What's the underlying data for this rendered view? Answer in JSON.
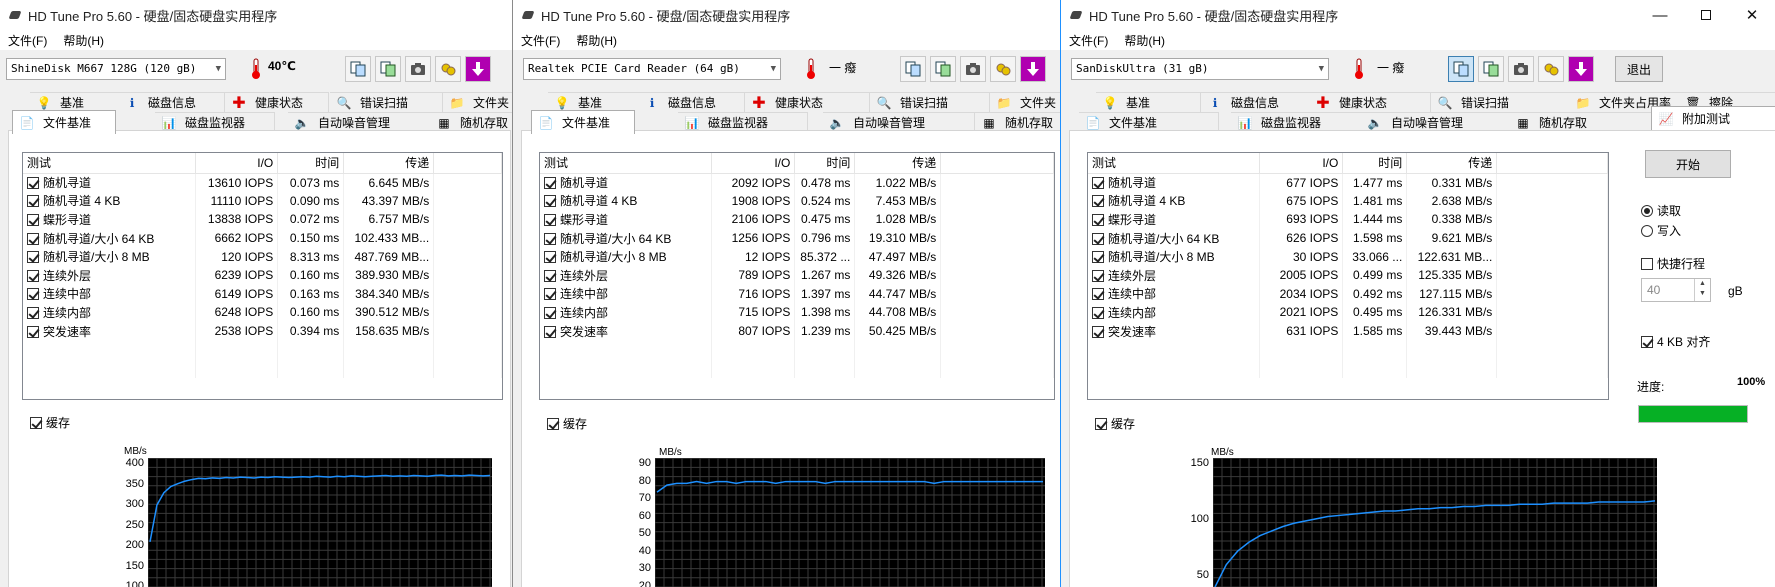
{
  "windows": [
    {
      "title": "HD Tune Pro 5.60 - 硬盘/固态硬盘实用程序",
      "menu": [
        "文件(F)",
        "帮助(H)"
      ],
      "drive": "ShineDisk M667 128G (120 gB)",
      "temperature": "40℃",
      "tabs_row1": [
        "基准",
        "磁盘信息",
        "健康状态",
        "错误扫描",
        "文件夹"
      ],
      "tabs_row2": [
        "文件基准",
        "磁盘监视器",
        "自动噪音管理",
        "随机存取"
      ],
      "table_headers": [
        "测试",
        "I/O",
        "时间",
        "传递"
      ],
      "rows": [
        {
          "test": "随机寻道",
          "io": "13610 IOPS",
          "time": "0.073 ms",
          "transfer": "6.645 MB/s"
        },
        {
          "test": "随机寻道 4 KB",
          "io": "11110 IOPS",
          "time": "0.090 ms",
          "transfer": "43.397 MB/s"
        },
        {
          "test": "蝶形寻道",
          "io": "13838 IOPS",
          "time": "0.072 ms",
          "transfer": "6.757 MB/s"
        },
        {
          "test": "随机寻道/大小 64 KB",
          "io": "6662 IOPS",
          "time": "0.150 ms",
          "transfer": "102.433 MB..."
        },
        {
          "test": "随机寻道/大小 8 MB",
          "io": "120 IOPS",
          "time": "8.313 ms",
          "transfer": "487.769 MB..."
        },
        {
          "test": "连续外层",
          "io": "6239 IOPS",
          "time": "0.160 ms",
          "transfer": "389.930 MB/s"
        },
        {
          "test": "连续中部",
          "io": "6149 IOPS",
          "time": "0.163 ms",
          "transfer": "384.340 MB/s"
        },
        {
          "test": "连续内部",
          "io": "6248 IOPS",
          "time": "0.160 ms",
          "transfer": "390.512 MB/s"
        },
        {
          "test": "突发速率",
          "io": "2538 IOPS",
          "time": "0.394 ms",
          "transfer": "158.635 MB/s"
        }
      ],
      "cache_label": "缓存"
    },
    {
      "title": "HD Tune Pro 5.60 - 硬盘/固态硬盘实用程序",
      "menu": [
        "文件(F)",
        "帮助(H)"
      ],
      "drive": "Realtek PCIE Card Reader (64 gB)",
      "temperature": "一 癈",
      "tabs_row1": [
        "基准",
        "磁盘信息",
        "健康状态",
        "错误扫描",
        "文件夹"
      ],
      "tabs_row2": [
        "文件基准",
        "磁盘监视器",
        "自动噪音管理",
        "随机存取"
      ],
      "table_headers": [
        "测试",
        "I/O",
        "时间",
        "传递"
      ],
      "rows": [
        {
          "test": "随机寻道",
          "io": "2092 IOPS",
          "time": "0.478 ms",
          "transfer": "1.022 MB/s"
        },
        {
          "test": "随机寻道 4 KB",
          "io": "1908 IOPS",
          "time": "0.524 ms",
          "transfer": "7.453 MB/s"
        },
        {
          "test": "蝶形寻道",
          "io": "2106 IOPS",
          "time": "0.475 ms",
          "transfer": "1.028 MB/s"
        },
        {
          "test": "随机寻道/大小 64 KB",
          "io": "1256 IOPS",
          "time": "0.796 ms",
          "transfer": "19.310 MB/s"
        },
        {
          "test": "随机寻道/大小 8 MB",
          "io": "12 IOPS",
          "time": "85.372 ...",
          "transfer": "47.497 MB/s"
        },
        {
          "test": "连续外层",
          "io": "789 IOPS",
          "time": "1.267 ms",
          "transfer": "49.326 MB/s"
        },
        {
          "test": "连续中部",
          "io": "716 IOPS",
          "time": "1.397 ms",
          "transfer": "44.747 MB/s"
        },
        {
          "test": "连续内部",
          "io": "715 IOPS",
          "time": "1.398 ms",
          "transfer": "44.708 MB/s"
        },
        {
          "test": "突发速率",
          "io": "807 IOPS",
          "time": "1.239 ms",
          "transfer": "50.425 MB/s"
        }
      ],
      "cache_label": "缓存"
    },
    {
      "title": "HD Tune Pro 5.60 - 硬盘/固态硬盘实用程序",
      "menu": [
        "文件(F)",
        "帮助(H)"
      ],
      "drive": "SanDiskUltra (31 gB)",
      "temperature": "一 癈",
      "exit_label": "退出",
      "tabs_row1": [
        "基准",
        "磁盘信息",
        "健康状态",
        "错误扫描",
        "文件夹占用率",
        "擦除"
      ],
      "tabs_row2": [
        "文件基准",
        "磁盘监视器",
        "自动噪音管理",
        "随机存取",
        "附加测试"
      ],
      "table_headers": [
        "测试",
        "I/O",
        "时间",
        "传递"
      ],
      "rows": [
        {
          "test": "随机寻道",
          "io": "677 IOPS",
          "time": "1.477 ms",
          "transfer": "0.331 MB/s"
        },
        {
          "test": "随机寻道 4 KB",
          "io": "675 IOPS",
          "time": "1.481 ms",
          "transfer": "2.638 MB/s"
        },
        {
          "test": "蝶形寻道",
          "io": "693 IOPS",
          "time": "1.444 ms",
          "transfer": "0.338 MB/s"
        },
        {
          "test": "随机寻道/大小 64 KB",
          "io": "626 IOPS",
          "time": "1.598 ms",
          "transfer": "9.621 MB/s"
        },
        {
          "test": "随机寻道/大小 8 MB",
          "io": "30 IOPS",
          "time": "33.066 ...",
          "transfer": "122.631 MB..."
        },
        {
          "test": "连续外层",
          "io": "2005 IOPS",
          "time": "0.499 ms",
          "transfer": "125.335 MB/s"
        },
        {
          "test": "连续中部",
          "io": "2034 IOPS",
          "time": "0.492 ms",
          "transfer": "127.115 MB/s"
        },
        {
          "test": "连续内部",
          "io": "2021 IOPS",
          "time": "0.495 ms",
          "transfer": "126.331 MB/s"
        },
        {
          "test": "突发速率",
          "io": "631 IOPS",
          "time": "1.585 ms",
          "transfer": "39.443 MB/s"
        }
      ],
      "cache_label": "缓存",
      "side": {
        "start": "开始",
        "read": "读取",
        "write": "写入",
        "short_stroke": "快捷行程",
        "spin_value": "40",
        "unit": "gB",
        "align": "4 KB 对齐",
        "progress_label": "进度:",
        "progress_text": "100%",
        "progress": 1.0
      }
    }
  ],
  "chart_data": [
    {
      "type": "line",
      "ylabel": "MB/s",
      "yticks": [
        100,
        150,
        200,
        250,
        300,
        350,
        400
      ],
      "ylim": [
        100,
        400
      ],
      "series": [
        {
          "values": [
            210,
            300,
            330,
            345,
            352,
            358,
            362,
            365,
            364,
            366,
            365,
            367,
            366,
            368,
            367,
            366,
            368,
            367,
            369,
            368,
            367,
            368,
            369,
            368,
            370,
            369,
            368,
            370,
            369,
            371,
            370,
            369,
            370,
            371,
            372,
            370,
            371,
            370,
            372,
            371,
            370,
            372,
            373,
            371,
            372,
            371,
            373,
            372,
            371,
            372
          ]
        }
      ],
      "line_color": "#1e90ff"
    },
    {
      "type": "line",
      "ylabel": "MB/s",
      "yticks": [
        20,
        30,
        40,
        50,
        60,
        70,
        80,
        90
      ],
      "ylim": [
        20,
        90
      ],
      "series": [
        {
          "values": [
            74,
            78,
            79,
            79,
            80,
            79,
            80,
            80,
            79,
            80,
            80,
            80,
            79,
            80,
            80,
            80,
            80,
            79,
            80,
            80,
            80,
            80,
            80,
            80,
            80,
            80,
            80,
            80,
            79,
            80,
            80,
            80,
            80,
            80,
            80,
            80,
            80,
            80,
            80,
            80
          ]
        }
      ],
      "line_color": "#1e90ff"
    },
    {
      "type": "line",
      "ylabel": "MB/s",
      "yticks": [
        50,
        100,
        150
      ],
      "ylim": [
        40,
        150
      ],
      "series": [
        {
          "values": [
            40,
            60,
            72,
            80,
            86,
            90,
            94,
            97,
            99,
            101,
            103,
            104,
            105,
            106,
            107,
            108,
            108,
            109,
            110,
            110,
            111,
            111,
            112,
            112,
            113,
            113,
            113,
            114,
            114,
            114,
            115,
            115,
            115,
            115,
            116,
            116,
            116,
            116,
            116,
            117
          ]
        }
      ],
      "line_color": "#1e90ff"
    }
  ],
  "colors": {
    "progress_fill": "#06b025",
    "chart_bg": "#000000",
    "chart_grid": "#3a3a3a"
  }
}
